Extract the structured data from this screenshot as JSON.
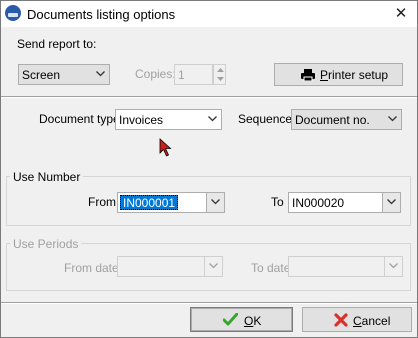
{
  "window": {
    "title": "Documents listing options",
    "close_symbol": "✕"
  },
  "send_report": {
    "label": "Send report to:",
    "destination": "Screen",
    "copies_label": "Copies:",
    "copies_value": "1",
    "printer_setup_prefix": "",
    "printer_setup_underlined": "P",
    "printer_setup_rest": "rinter setup"
  },
  "document_type": {
    "label": "Document type",
    "value": "Invoices"
  },
  "sequence": {
    "label": "Sequence",
    "value": "Document no."
  },
  "use_number": {
    "title": "Use Number",
    "from_label": "From",
    "from_value": "IN000001",
    "to_label": "To",
    "to_value": "IN000020"
  },
  "use_periods": {
    "title": "Use Periods",
    "from_date_label": "From date",
    "to_date_label": "To date"
  },
  "buttons": {
    "ok_underlined": "O",
    "ok_rest": "K",
    "cancel_underlined": "C",
    "cancel_rest": "ancel"
  },
  "colors": {
    "selection": "#0078d7",
    "ok_check": "#3aa52e",
    "cancel_x": "#d9322a"
  },
  "icons": {
    "printer": "printer-icon",
    "ok": "checkmark-icon",
    "cancel": "red-x-icon"
  }
}
